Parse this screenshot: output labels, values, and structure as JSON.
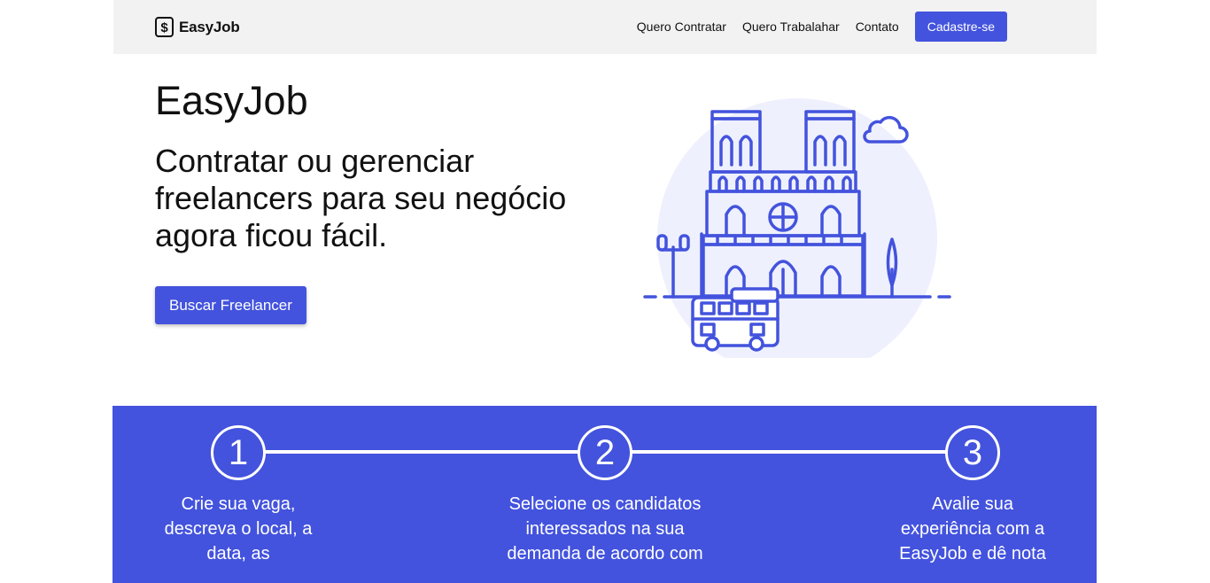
{
  "navbar": {
    "brand": "EasyJob",
    "brand_icon": "dollar-box-icon",
    "links": [
      "Quero Contratar",
      "Quero Trabalahar",
      "Contato"
    ],
    "cta": "Cadastre-se"
  },
  "hero": {
    "title": "EasyJob",
    "subtitle": "Contratar ou gerenciar freelancers para seu negócio agora ficou fácil.",
    "button": "Buscar Freelancer",
    "illustration": "cathedral-illustration"
  },
  "steps": [
    {
      "number": "1",
      "text": "Crie sua vaga, descreva o local, a data, as"
    },
    {
      "number": "2",
      "text": "Selecione os candidatos interessados na sua demanda de acordo com"
    },
    {
      "number": "3",
      "text": "Avalie sua experiência com a EasyJob e dê nota"
    }
  ],
  "colors": {
    "accent": "#4353dd",
    "nav_bg": "#f2f2f2",
    "illustration_bg": "#eef0fd"
  }
}
